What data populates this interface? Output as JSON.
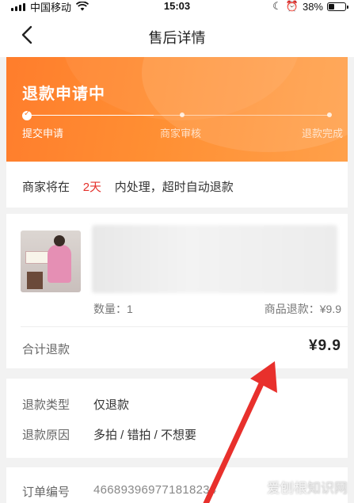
{
  "status_bar": {
    "carrier": "中国移动",
    "time": "15:03",
    "battery": "38%",
    "battery_level": 0.38
  },
  "nav": {
    "title": "售后详情",
    "back_icon": "chevron-left-icon"
  },
  "banner": {
    "status": "退款申请中",
    "steps": [
      "提交申请",
      "商家审核",
      "退款完成"
    ],
    "current_step": 1,
    "colors": {
      "gradient_start": "#ff7d2c",
      "gradient_end": "#ffa04a"
    }
  },
  "notice": {
    "prefix": "商家将在",
    "days": "2天",
    "suffix": "内处理，超时自动退款",
    "highlight_color": "#e4312b"
  },
  "product": {
    "quantity_label": "数量：1",
    "refund_label": "商品退款：¥9.9",
    "total_label": "合计退款",
    "total_value": "¥9.9"
  },
  "refund_info": {
    "type_label": "退款类型",
    "type_value": "仅退款",
    "reason_label": "退款原因",
    "reason_value": "多拍 / 错拍 / 不想要"
  },
  "order": {
    "label": "订单编号",
    "value": "466893969771818234"
  },
  "watermark": {
    "text_a": "爱刨根",
    "text_b": "知识网"
  },
  "annotation": {
    "color": "#e8302c"
  }
}
